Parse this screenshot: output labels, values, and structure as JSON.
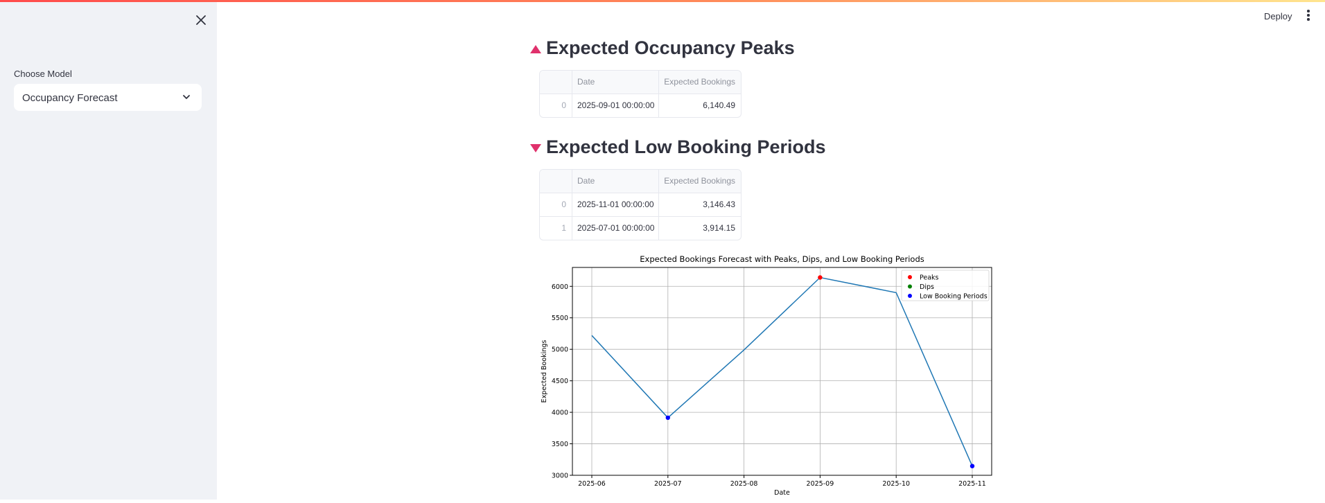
{
  "app": {
    "deploy_label": "Deploy"
  },
  "sidebar": {
    "close_icon": "close-icon",
    "model_label": "Choose Model",
    "model_value": "Occupancy Forecast"
  },
  "peaks": {
    "title": "Expected Occupancy Peaks",
    "icon": "triangle-up-icon",
    "columns": [
      "",
      "Date",
      "Expected Bookings"
    ],
    "rows": [
      {
        "index": "0",
        "date": "2025-09-01 00:00:00",
        "bookings": "6,140.49"
      }
    ]
  },
  "lows": {
    "title": "Expected Low Booking Periods",
    "icon": "triangle-down-icon",
    "columns": [
      "",
      "Date",
      "Expected Bookings"
    ],
    "rows": [
      {
        "index": "0",
        "date": "2025-11-01 00:00:00",
        "bookings": "3,146.43"
      },
      {
        "index": "1",
        "date": "2025-07-01 00:00:00",
        "bookings": "3,914.15"
      }
    ]
  },
  "colors": {
    "accent": "#ff4b4b",
    "heading_icon": "#e0316c",
    "line": "#1f77b4",
    "peak": "#ff0000",
    "dip": "#008000",
    "low": "#0000ff"
  },
  "chart_data": {
    "type": "line",
    "title": "Expected Bookings Forecast with Peaks, Dips, and Low Booking Periods",
    "xlabel": "Date",
    "ylabel": "Expected Bookings",
    "x": [
      "2025-06",
      "2025-07",
      "2025-08",
      "2025-09",
      "2025-10",
      "2025-11"
    ],
    "x_ticks": [
      "2025-06",
      "2025-07",
      "2025-08",
      "2025-09",
      "2025-10",
      "2025-11"
    ],
    "series": [
      {
        "values": [
          5220,
          3914.15,
          4990,
          6140.49,
          5900,
          3146.43
        ]
      }
    ],
    "markers": {
      "Peaks": [
        {
          "x": "2025-09",
          "y": 6140.49
        }
      ],
      "Dips": [],
      "Low Booking Periods": [
        {
          "x": "2025-07",
          "y": 3914.15
        },
        {
          "x": "2025-11",
          "y": 3146.43
        }
      ]
    },
    "legend": [
      "Peaks",
      "Dips",
      "Low Booking Periods"
    ],
    "legend_position": "top-right",
    "ylim": [
      3000,
      6300
    ],
    "y_ticks": [
      3000,
      3500,
      4000,
      4500,
      5000,
      5500,
      6000
    ],
    "grid": true
  }
}
